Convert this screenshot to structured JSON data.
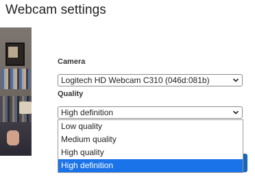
{
  "header": {
    "title": "Webcam settings"
  },
  "camera": {
    "label": "Camera",
    "selected": "Logitech HD Webcam C310 (046d:081b)"
  },
  "quality": {
    "label": "Quality",
    "selected": "High definition",
    "options": [
      "Low quality",
      "Medium quality",
      "High quality",
      "High definition"
    ],
    "highlighted_index": 3
  },
  "icons": {
    "camera_select": "chevron-down-icon",
    "quality_select": "chevron-down-icon"
  },
  "colors": {
    "highlight": "#1a73e8",
    "button": "#1a67b8"
  }
}
